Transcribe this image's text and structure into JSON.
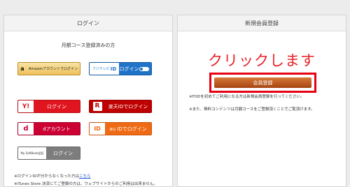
{
  "login": {
    "header": "ログイン",
    "members_label": "月額コース登録済みの方",
    "amazon": {
      "icon": "a",
      "label": "Amazonアカウントでログイン"
    },
    "fuji": {
      "brand": "フジテレビ",
      "id_mark": "ID",
      "label": "ログイン"
    },
    "yahoo": {
      "icon": "Y!",
      "label": "ログイン"
    },
    "rakuten": {
      "icon": "R",
      "label": "楽天IDでログイン"
    },
    "dacc": {
      "icon": "d",
      "label": "dアカウント"
    },
    "au": {
      "icon": "ID",
      "label": "au IDでログイン"
    },
    "softbank": {
      "brand": "My SoftBank認証",
      "label": "ログイン"
    },
    "note1_text": "※ログインIDが分からなくなった方は",
    "note1_link": "こちら",
    "note2": "※iTunes Store 決済にてご登録の方は、ウェブサイトからのご利用は出来ません。"
  },
  "signup": {
    "header": "新規会員登録",
    "annotation": "クリックします",
    "button": "会員登録",
    "note1": "※FODを初めてご利用になる方は新規会員登録を行ってください。",
    "note2": "※また、無料コンテンツは月額コースをご登録頂くことでご覧頂けます。"
  },
  "colors": {
    "annotation": "#e8232a",
    "highlight": "#e60012",
    "link": "#1a4fd0"
  }
}
